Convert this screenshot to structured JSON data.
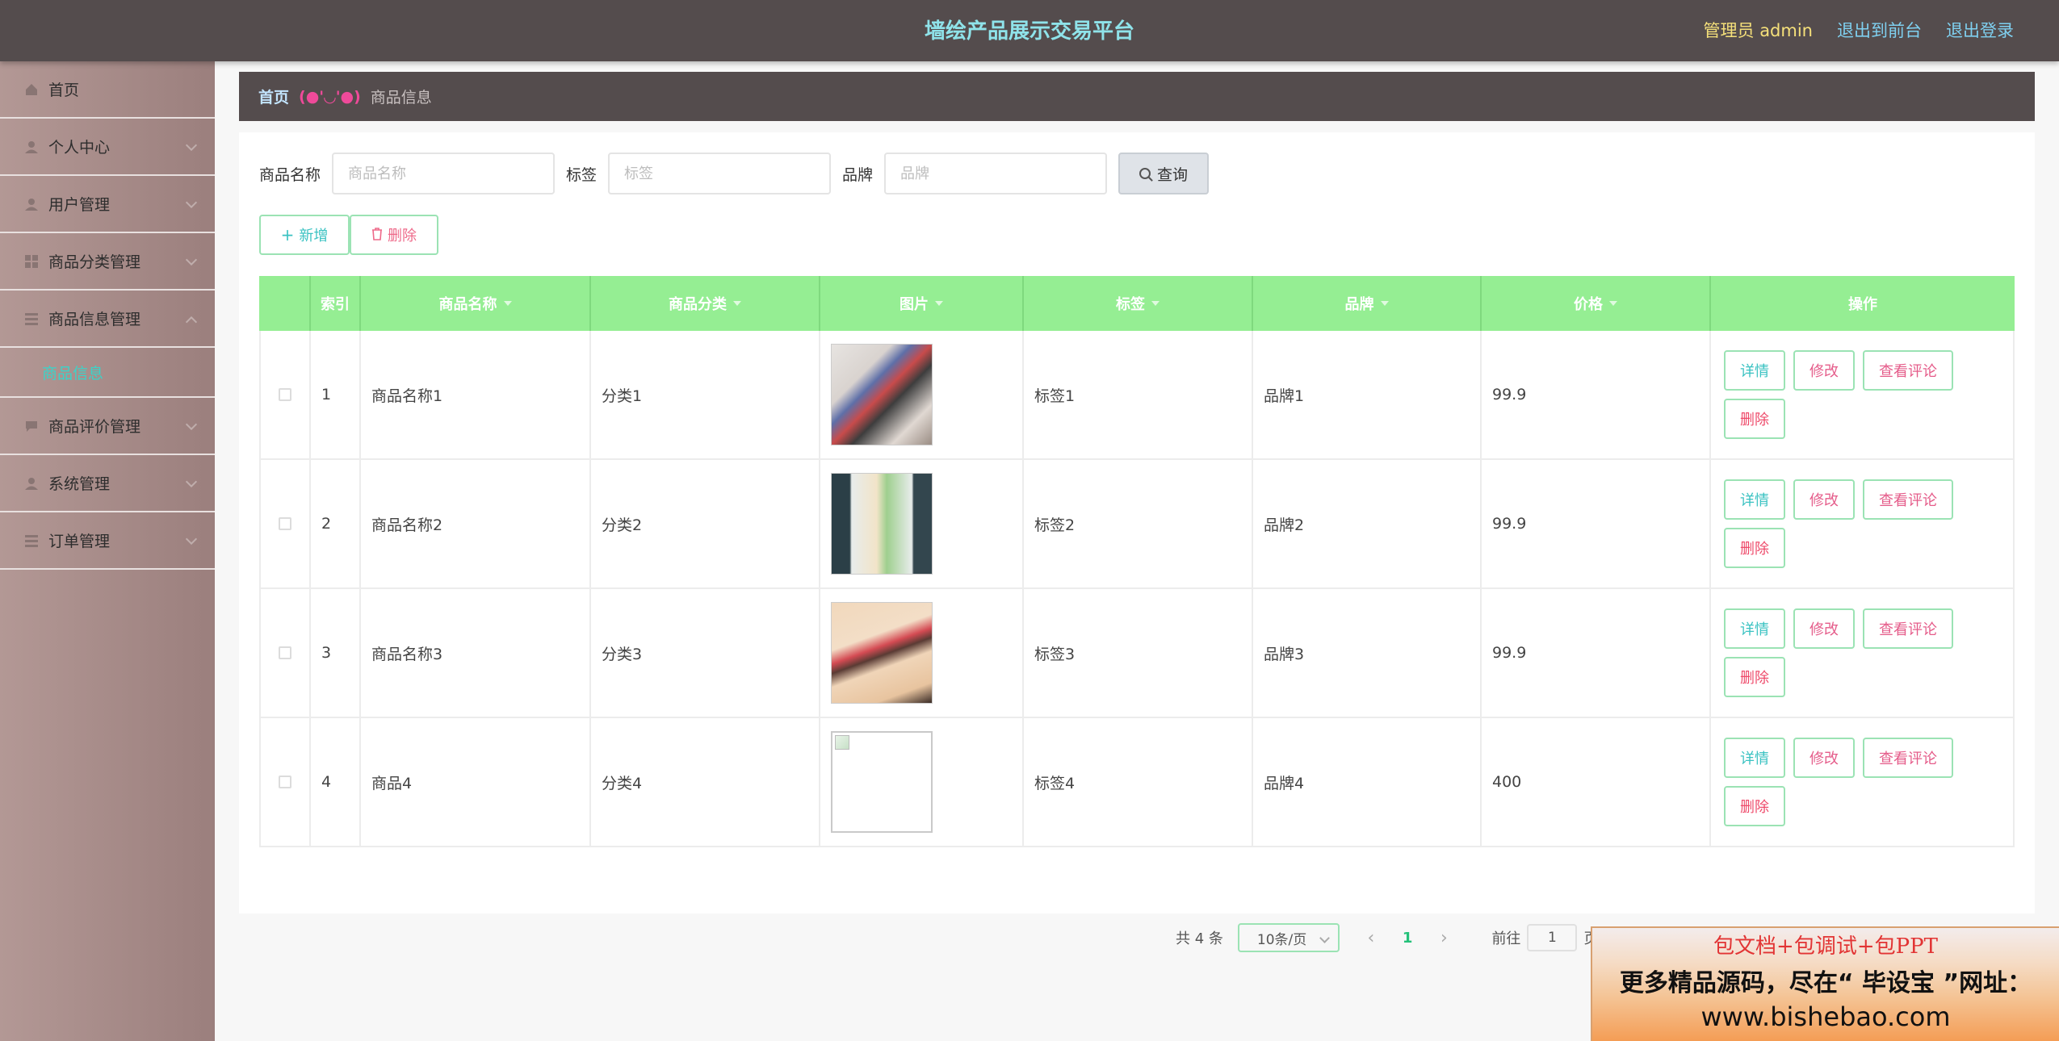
{
  "header": {
    "title": "墙绘产品展示交易平台",
    "admin": "管理员 admin",
    "to_front": "退出到前台",
    "logout": "退出登录"
  },
  "sidebar": {
    "items": [
      {
        "label": "首页",
        "icon": "home-icon"
      },
      {
        "label": "个人中心",
        "icon": "user-icon"
      },
      {
        "label": "用户管理",
        "icon": "user-icon"
      },
      {
        "label": "商品分类管理",
        "icon": "grid-icon"
      },
      {
        "label": "商品信息管理",
        "icon": "list-icon"
      },
      {
        "label": "商品信息",
        "icon": ""
      },
      {
        "label": "商品评价管理",
        "icon": "chat-icon"
      },
      {
        "label": "系统管理",
        "icon": "user-icon"
      },
      {
        "label": "订单管理",
        "icon": "list-icon"
      }
    ]
  },
  "breadcrumb": {
    "home": "首页",
    "separator": "(●'◡'●)",
    "current": "商品信息"
  },
  "search": {
    "name_label": "商品名称",
    "name_placeholder": "商品名称",
    "tag_label": "标签",
    "tag_placeholder": "标签",
    "brand_label": "品牌",
    "brand_placeholder": "品牌",
    "query_label": "查询"
  },
  "actions": {
    "add_label": "新增",
    "delete_label": "删除"
  },
  "table": {
    "columns": [
      "索引",
      "商品名称",
      "商品分类",
      "图片",
      "标签",
      "品牌",
      "价格",
      "操作"
    ],
    "rows": [
      {
        "index": "1",
        "name": "商品名称1",
        "category": "分类1",
        "tag": "标签1",
        "brand": "品牌1",
        "price": "99.9"
      },
      {
        "index": "2",
        "name": "商品名称2",
        "category": "分类2",
        "tag": "标签2",
        "brand": "品牌2",
        "price": "99.9"
      },
      {
        "index": "3",
        "name": "商品名称3",
        "category": "分类3",
        "tag": "标签3",
        "brand": "品牌3",
        "price": "99.9"
      },
      {
        "index": "4",
        "name": "商品4",
        "category": "分类4",
        "tag": "标签4",
        "brand": "品牌4",
        "price": "400"
      }
    ],
    "ops": {
      "detail": "详情",
      "edit": "修改",
      "review": "查看评论",
      "delete": "删除"
    }
  },
  "pager": {
    "total": "共 4 条",
    "page_size": "10条/页",
    "prev": "‹",
    "current_page": "1",
    "next": "›",
    "goto_label": "前往",
    "goto_value": "1",
    "page_unit": "页"
  },
  "ad": {
    "line1": "包文档+包调试+包PPT",
    "line2": "更多精品源码，尽在“ 毕设宝 ”网址：",
    "line3": "www.bishebao.com"
  }
}
